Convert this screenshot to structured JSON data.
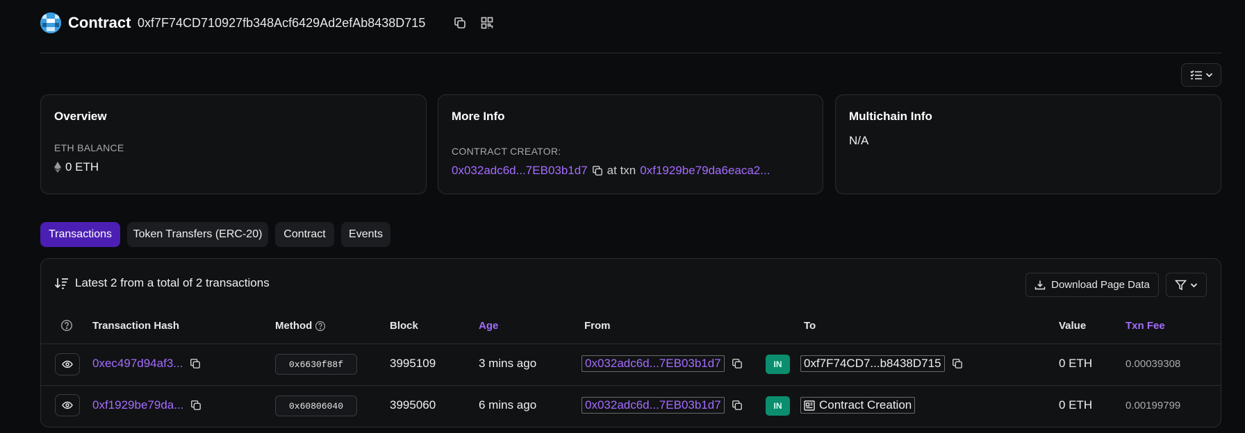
{
  "header": {
    "title": "Contract",
    "address": "0xf7F74CD710927fb348Acf6429Ad2efAb8438D715",
    "copy_icon": "copy-icon",
    "qr_icon": "qr-code-icon"
  },
  "cards": {
    "overview": {
      "title": "Overview",
      "balance_label": "ETH BALANCE",
      "balance_value": "0 ETH"
    },
    "more_info": {
      "title": "More Info",
      "creator_label": "CONTRACT CREATOR:",
      "creator_address": "0x032adc6d...7EB03b1d7",
      "at_txn_text": "at txn",
      "creator_txn": "0xf1929be79da6eaca2..."
    },
    "multichain": {
      "title": "Multichain Info",
      "value": "N/A"
    }
  },
  "tabs": [
    {
      "label": "Transactions",
      "active": true
    },
    {
      "label": "Token Transfers (ERC-20)",
      "active": false
    },
    {
      "label": "Contract",
      "active": false
    },
    {
      "label": "Events",
      "active": false
    }
  ],
  "table": {
    "summary": "Latest 2 from a total of 2 transactions",
    "download_label": "Download Page Data",
    "columns": {
      "hash": "Transaction Hash",
      "method": "Method",
      "block": "Block",
      "age": "Age",
      "from": "From",
      "to": "To",
      "value": "Value",
      "fee": "Txn Fee"
    },
    "rows": [
      {
        "hash": "0xec497d94af3...",
        "method": "0x6630f88f",
        "block": "3995109",
        "age": "3 mins ago",
        "from": "0x032adc6d...7EB03b1d7",
        "direction": "IN",
        "to": "0xf7F74CD7...b8438D715",
        "value": "0 ETH",
        "fee": "0.00039308"
      },
      {
        "hash": "0xf1929be79da...",
        "method": "0x60806040",
        "block": "3995060",
        "age": "6 mins ago",
        "from": "0x032adc6d...7EB03b1d7",
        "direction": "IN",
        "to": "Contract Creation",
        "value": "0 ETH",
        "fee": "0.00199799"
      }
    ]
  },
  "colors": {
    "background": "#0b0c0e",
    "accent": "#a46cff",
    "active_tab": "#4b1fb3",
    "in_badge": "#0b8e6e"
  }
}
